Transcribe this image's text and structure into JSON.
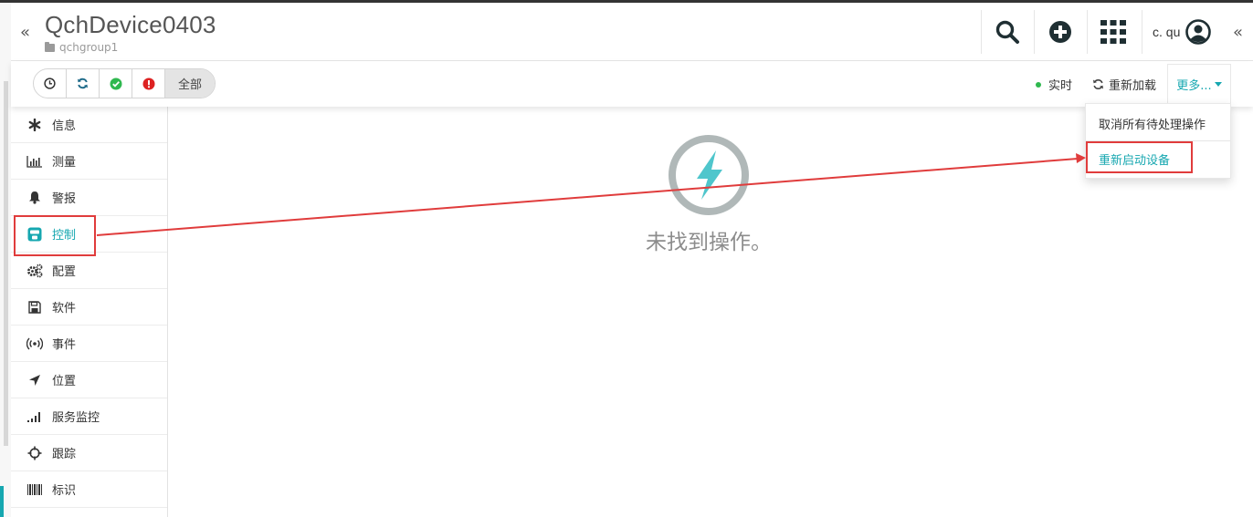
{
  "header": {
    "title": "QchDevice0403",
    "group": "qchgroup1",
    "user_name": "c. qu",
    "collapse_left": "«",
    "collapse_right": "«"
  },
  "toolbar": {
    "filter_all_label": "全部",
    "realtime_label": "实时",
    "reload_label": "重新加载",
    "more_label": "更多..."
  },
  "dropdown": {
    "items": [
      {
        "label": "取消所有待处理操作"
      },
      {
        "label": "重新启动设备"
      }
    ]
  },
  "sidebar": {
    "items": [
      {
        "label": "信息",
        "icon": "asterisk-icon"
      },
      {
        "label": "测量",
        "icon": "bar-chart-icon"
      },
      {
        "label": "警报",
        "icon": "bell-icon"
      },
      {
        "label": "控制",
        "icon": "control-icon",
        "active": true
      },
      {
        "label": "配置",
        "icon": "cogs-icon"
      },
      {
        "label": "软件",
        "icon": "floppy-icon"
      },
      {
        "label": "事件",
        "icon": "broadcast-icon"
      },
      {
        "label": "位置",
        "icon": "location-arrow-icon"
      },
      {
        "label": "服务监控",
        "icon": "signal-bars-icon"
      },
      {
        "label": "跟踪",
        "icon": "crosshair-icon"
      },
      {
        "label": "标识",
        "icon": "barcode-icon"
      }
    ]
  },
  "main": {
    "empty_text": "未找到操作。"
  },
  "colors": {
    "accent": "#16a7b0",
    "annotation": "#e03c3c",
    "status_green": "#2fb84f"
  }
}
